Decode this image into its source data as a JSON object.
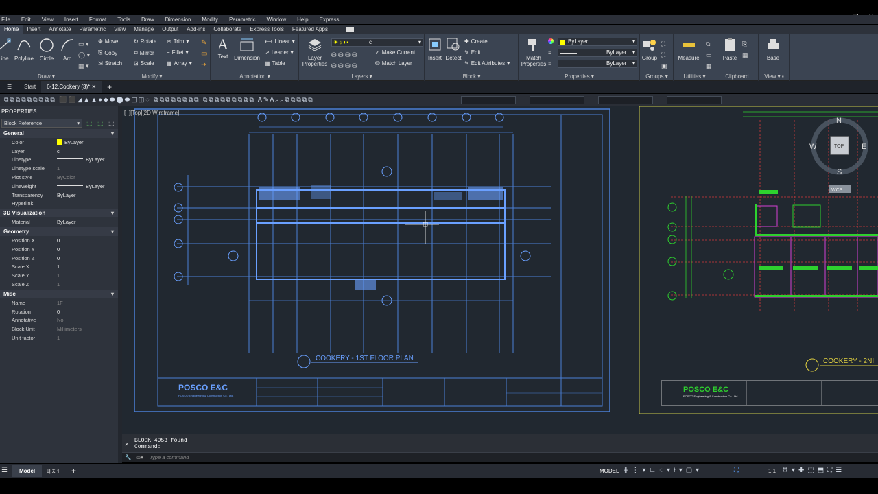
{
  "menu": [
    "File",
    "Edit",
    "View",
    "Insert",
    "Format",
    "Tools",
    "Draw",
    "Dimension",
    "Modify",
    "Parametric",
    "Window",
    "Help",
    "Express"
  ],
  "ribbon_tabs": [
    "Home",
    "Insert",
    "Annotate",
    "Parametric",
    "View",
    "Manage",
    "Output",
    "Add-ins",
    "Collaborate",
    "Express Tools",
    "Featured Apps"
  ],
  "ribbon": {
    "draw": {
      "title": "Draw",
      "line": "Line",
      "polyline": "Polyline",
      "circle": "Circle",
      "arc": "Arc"
    },
    "modify": {
      "title": "Modify",
      "move": "Move",
      "rotate": "Rotate",
      "trim": "Trim",
      "copy": "Copy",
      "mirror": "Mirror",
      "fillet": "Fillet",
      "stretch": "Stretch",
      "scale": "Scale",
      "array": "Array"
    },
    "annotation": {
      "title": "Annotation",
      "text": "Text",
      "dimension": "Dimension",
      "linear": "Linear",
      "leader": "Leader",
      "table": "Table"
    },
    "layers": {
      "title": "Layers",
      "layer_properties": "Layer Properties",
      "current_layer": "c",
      "make_current": "Make Current",
      "match_layer": "Match Layer"
    },
    "block": {
      "title": "Block",
      "insert": "Insert",
      "detect": "Detect",
      "create": "Create",
      "edit": "Edit",
      "edit_attributes": "Edit Attributes"
    },
    "properties": {
      "title": "Properties",
      "match_properties": "Match Properties",
      "color": "ByLayer",
      "linetype": "ByLayer",
      "lineweight": "ByLayer"
    },
    "groups": {
      "title": "Groups",
      "group": "Group"
    },
    "utilities": {
      "title": "Utilities",
      "measure": "Measure"
    },
    "clipboard": {
      "title": "Clipboard",
      "paste": "Paste"
    },
    "view": {
      "title": "View",
      "base": "Base"
    }
  },
  "doc_tabs": {
    "start": "Start",
    "active": "6-12.Cookery (3)*"
  },
  "properties": {
    "header": "PROPERTIES",
    "selection": "Block Reference",
    "general_title": "General",
    "general": [
      {
        "k": "Color",
        "v": "ByLayer"
      },
      {
        "k": "Layer",
        "v": "c"
      },
      {
        "k": "Linetype",
        "v": "ByLayer"
      },
      {
        "k": "Linetype scale",
        "v": "1"
      },
      {
        "k": "Plot style",
        "v": "ByColor"
      },
      {
        "k": "Lineweight",
        "v": "ByLayer"
      },
      {
        "k": "Transparency",
        "v": "ByLayer"
      },
      {
        "k": "Hyperlink",
        "v": ""
      }
    ],
    "vis_title": "3D Visualization",
    "vis": [
      {
        "k": "Material",
        "v": "ByLayer"
      }
    ],
    "geom_title": "Geometry",
    "geom": [
      {
        "k": "Position X",
        "v": "0"
      },
      {
        "k": "Position Y",
        "v": "0"
      },
      {
        "k": "Position Z",
        "v": "0"
      },
      {
        "k": "Scale X",
        "v": "1"
      },
      {
        "k": "Scale Y",
        "v": "1"
      },
      {
        "k": "Scale Z",
        "v": "1"
      }
    ],
    "misc_title": "Misc",
    "misc": [
      {
        "k": "Name",
        "v": "1F"
      },
      {
        "k": "Rotation",
        "v": "0"
      },
      {
        "k": "Annotative",
        "v": "No"
      },
      {
        "k": "Block Unit",
        "v": "Millimeters"
      },
      {
        "k": "Unit factor",
        "v": "1"
      }
    ]
  },
  "viewport": {
    "label": "[−][Top][2D Wireframe]",
    "plan1_title": "COOKERY - 1ST FLOOR PLAN",
    "plan2_title": "COOKERY - 2NI",
    "logo": "POSCO E&C",
    "logo_sub": "POSCO Engineering & Construction Co., Ltd.",
    "viewcube": {
      "n": "N",
      "s": "S",
      "e": "E",
      "w": "W",
      "top": "TOP",
      "wcs": "WCS"
    }
  },
  "command": {
    "line1": "BLOCK 4953 found",
    "line2": "Command:",
    "placeholder": "Type a command"
  },
  "status": {
    "model_tab": "Model",
    "layout_tab": "배치1",
    "model": "MODEL",
    "scale": "1:1"
  }
}
